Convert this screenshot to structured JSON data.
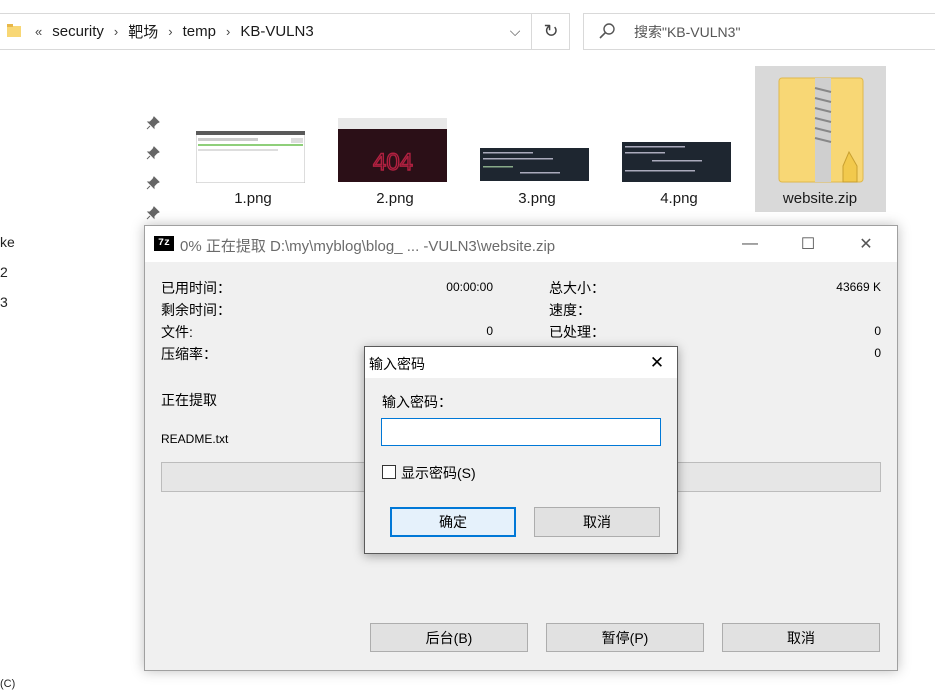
{
  "address_bar": {
    "overflow": "«",
    "crumbs": [
      "security",
      "靶场",
      "temp",
      "KB-VULN3"
    ],
    "separator": "›",
    "dropdown": "⌵",
    "refresh": "↻"
  },
  "search": {
    "placeholder": "搜索\"KB-VULN3\""
  },
  "left_nav": [
    "ke",
    "2",
    "3",
    "(C)"
  ],
  "files": [
    {
      "name": "1.png"
    },
    {
      "name": "2.png"
    },
    {
      "name": "3.png"
    },
    {
      "name": "4.png"
    },
    {
      "name": "website.zip"
    }
  ],
  "progress_window": {
    "icon": "7z",
    "title": "0% 正在提取 D:\\my\\myblog\\blog_ ... -VULN3\\website.zip",
    "controls": {
      "minimize": "—",
      "maximize": "☐",
      "close": "✕"
    },
    "elapsed_label": "已用时间：",
    "elapsed_value": "00:00:00",
    "remaining_label": "剩余时间：",
    "files_label": "文件:",
    "files_value": "0",
    "ratio_label": "压缩率：",
    "total_size_label": "总大小：",
    "total_size_value": "43669 K",
    "speed_label": "速度：",
    "processed_label": "已处理：",
    "processed_value": "0",
    "packed_value": "0",
    "status": "正在提取",
    "current_file": "README.txt",
    "progress_percent": 0,
    "buttons": {
      "background": "后台(B)",
      "pause": "暂停(P)",
      "cancel": "取消"
    }
  },
  "password_dialog": {
    "title": "输入密码",
    "close": "✕",
    "prompt": "输入密码：",
    "value": "",
    "show_password_label": "显示密码(S)",
    "show_password_checked": false,
    "ok": "确定",
    "cancel": "取消"
  },
  "colors": {
    "focus_border": "#0078d7",
    "folder_yellow": "#f8d775",
    "title_text_inactive": "#6b6b6b"
  }
}
